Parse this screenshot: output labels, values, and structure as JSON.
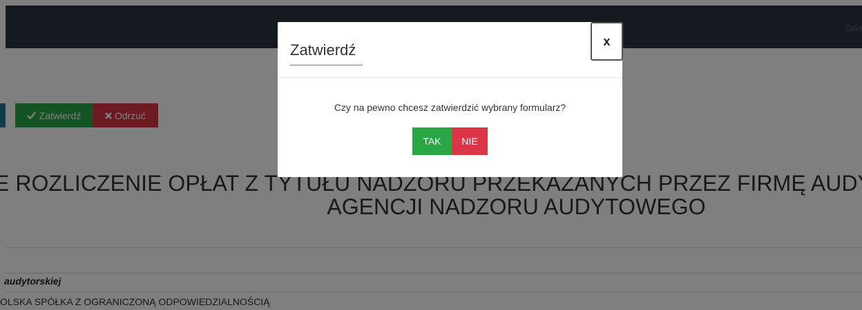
{
  "topbar": {
    "right_text": "Zalo"
  },
  "toolbar": {
    "confirm_label": "Zatwierdź",
    "confirm_icon": "check-icon",
    "reject_label": "Odrzuć",
    "reject_icon": "x-icon"
  },
  "page": {
    "title_line1": "E ROZLICZENIE OPŁAT Z TYTUŁU NADZORU PRZEKAZANYCH PRZEZ FIRMĘ AUDYTORSKĄ",
    "title_line2": "AGENCJI NADZORU AUDYTOWEGO",
    "auditor_label": "audytorskiej",
    "company_name": "OLSKA SPÓŁKA Z OGRANICZONĄ ODPOWIEDZIALNOŚCIĄ"
  },
  "modal": {
    "title": "Zatwierdź",
    "close_label": "x",
    "message": "Czy na pewno chcesz zatwierdzić wybrany formularz?",
    "yes_label": "TAK",
    "no_label": "NIE"
  },
  "colors": {
    "topbar": "#2a3440",
    "success": "#28a745",
    "danger": "#dc3545",
    "overlay": "rgba(0,0,0,0.5)"
  }
}
